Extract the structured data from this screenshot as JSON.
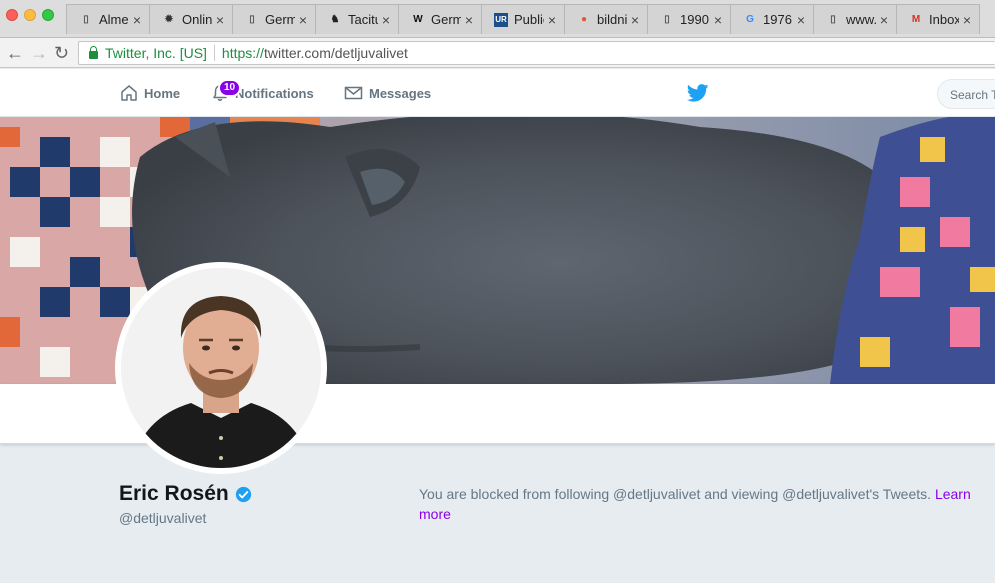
{
  "browser": {
    "tabs": [
      {
        "title": "Alme",
        "icon": "document-icon"
      },
      {
        "title": "Onlin",
        "icon": "web-icon"
      },
      {
        "title": "Germ",
        "icon": "document-icon"
      },
      {
        "title": "Tacitu",
        "icon": "tacitus-icon"
      },
      {
        "title": "Germ",
        "icon": "wikipedia-icon"
      },
      {
        "title": "Public",
        "icon": "ur-icon"
      },
      {
        "title": "bildni",
        "icon": "duckduckgo-icon"
      },
      {
        "title": "1990",
        "icon": "document-icon"
      },
      {
        "title": "1976",
        "icon": "google-icon"
      },
      {
        "title": "www.",
        "icon": "document-icon"
      },
      {
        "title": "Inbox",
        "icon": "gmail-icon"
      }
    ],
    "security_label": "Twitter, Inc. [US]",
    "url_scheme": "https://",
    "url_rest": "twitter.com/detljuvalivet"
  },
  "twitter_nav": {
    "home": "Home",
    "notifications": "Notifications",
    "notifications_count": "10",
    "messages": "Messages",
    "search_placeholder": "Search Twitter"
  },
  "profile": {
    "name": "Eric Rosén",
    "handle": "@detljuvalivet",
    "verified": true
  },
  "blocked_message": {
    "text": "You are blocked from following @detljuvalivet and viewing @detljuvalivet's Tweets.",
    "link": "Learn more"
  },
  "colors": {
    "accent": "#8a00e6",
    "twitter_blue": "#1da1f2",
    "background": "#e6ecf0"
  }
}
